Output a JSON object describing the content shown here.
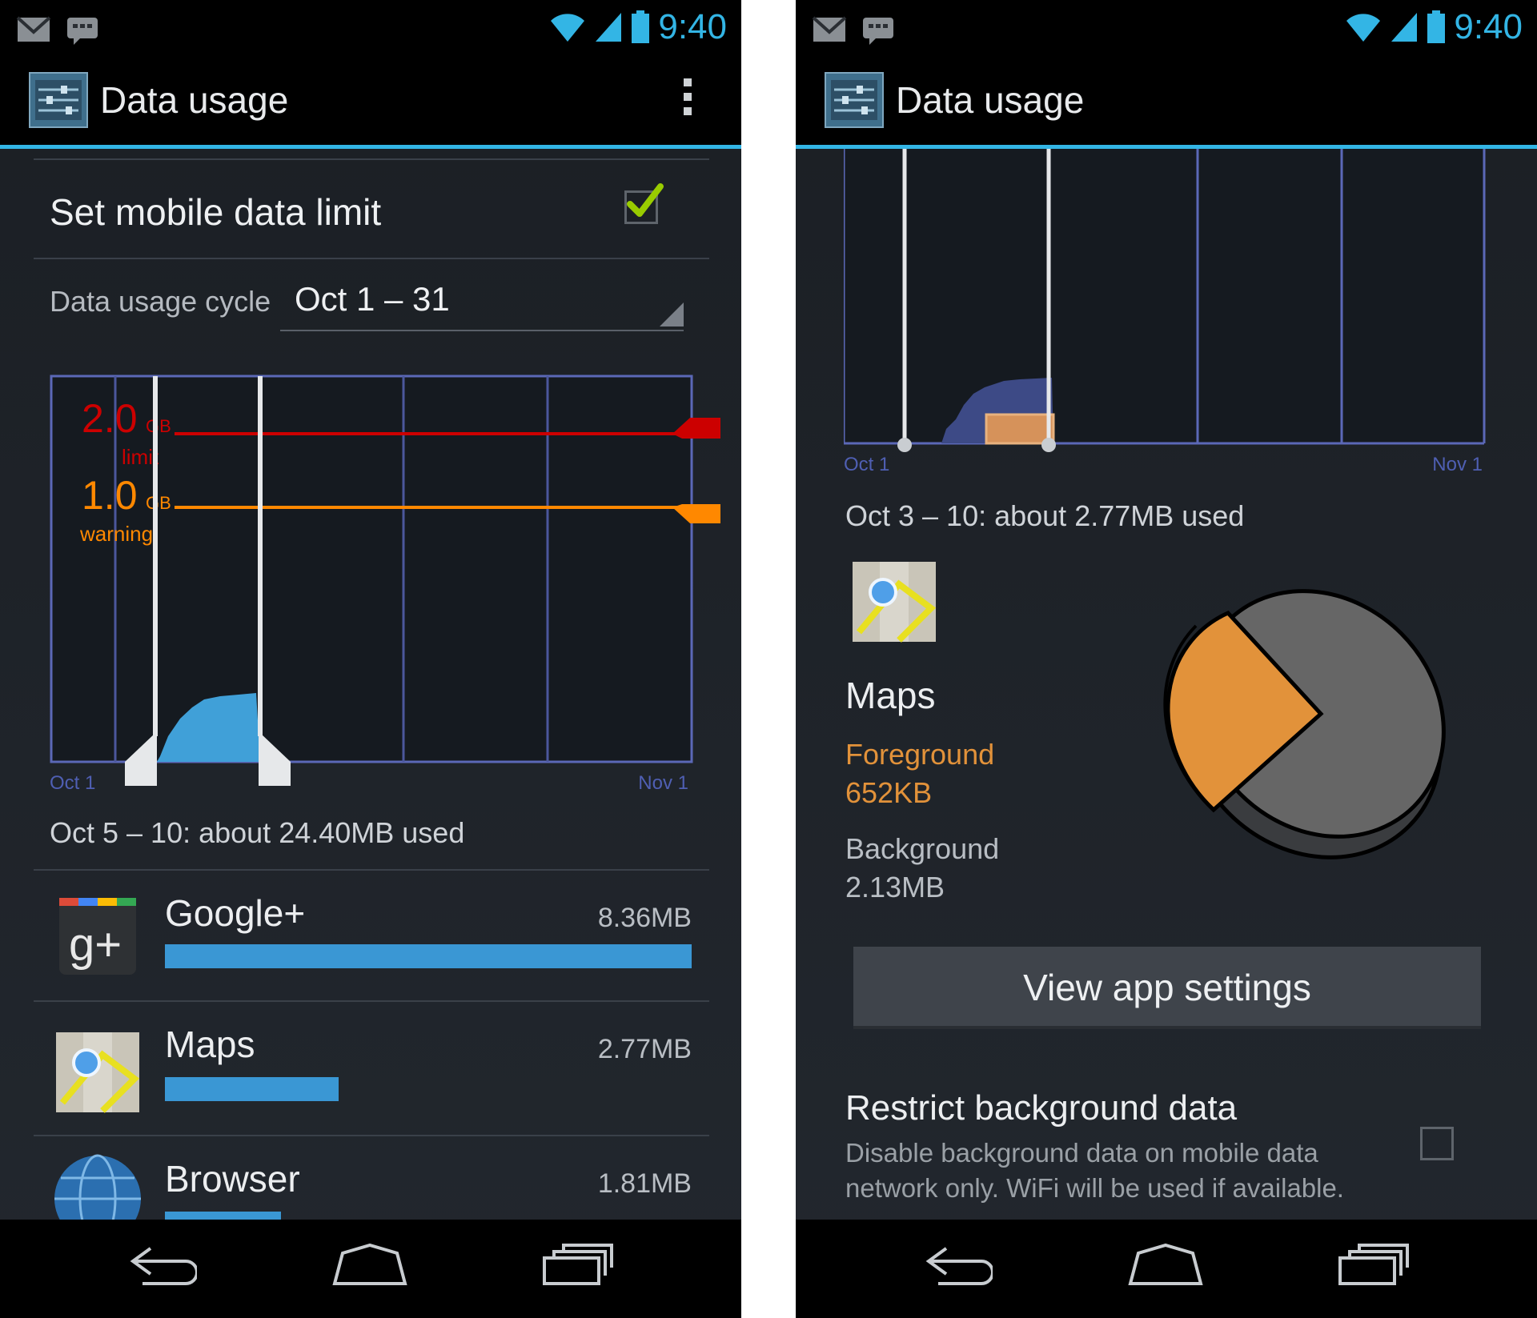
{
  "status_bar": {
    "time": "9:40"
  },
  "screen_title": "Data usage",
  "left": {
    "limit_setting": {
      "label": "Set mobile data limit",
      "checked": true
    },
    "cycle": {
      "label": "Data usage cycle",
      "value": "Oct 1 – 31"
    },
    "chart": {
      "limit_value": "2.0",
      "limit_unit": "GB",
      "limit_label": "limit",
      "warning_value": "1.0",
      "warning_unit": "GB",
      "warning_label": "warning",
      "x_start": "Oct 1",
      "x_end": "Nov 1",
      "limit_color": "#cc0000",
      "warning_color": "#ff8800"
    },
    "summary": "Oct 5 – 10: about 24.40MB used",
    "apps": [
      {
        "name": "Google+",
        "size": "8.36MB",
        "fraction": 1.0
      },
      {
        "name": "Maps",
        "size": "2.77MB",
        "fraction": 0.33
      },
      {
        "name": "Browser",
        "size": "1.81MB",
        "fraction": 0.22
      }
    ]
  },
  "right": {
    "chart": {
      "x_start": "Oct 1",
      "x_end": "Nov 1"
    },
    "summary": "Oct 3 – 10: about 2.77MB used",
    "app_name": "Maps",
    "foreground_label": "Foreground",
    "foreground_value": "652KB",
    "background_label": "Background",
    "background_value": "2.13MB",
    "foreground_color": "#e2923a",
    "background_color": "#666666",
    "view_settings_button": "View app settings",
    "restrict": {
      "title": "Restrict background data",
      "desc_line1": "Disable background data on mobile data",
      "desc_line2": "network only. WiFi will be used if available.",
      "checked": false
    }
  }
}
